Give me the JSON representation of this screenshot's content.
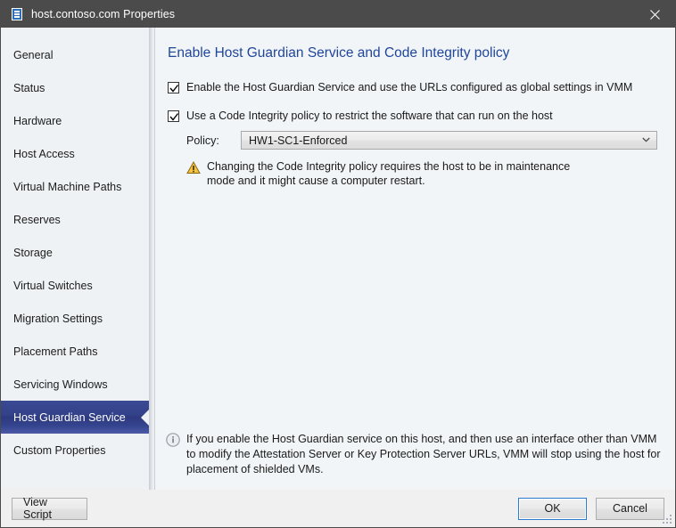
{
  "window": {
    "title": "host.contoso.com Properties",
    "title_icon": "server-icon",
    "close_icon": "close-icon"
  },
  "sidebar": {
    "items": [
      {
        "label": "General",
        "selected": false
      },
      {
        "label": "Status",
        "selected": false
      },
      {
        "label": "Hardware",
        "selected": false
      },
      {
        "label": "Host Access",
        "selected": false
      },
      {
        "label": "Virtual Machine Paths",
        "selected": false
      },
      {
        "label": "Reserves",
        "selected": false
      },
      {
        "label": "Storage",
        "selected": false
      },
      {
        "label": "Virtual Switches",
        "selected": false
      },
      {
        "label": "Migration Settings",
        "selected": false
      },
      {
        "label": "Placement Paths",
        "selected": false
      },
      {
        "label": "Servicing Windows",
        "selected": false
      },
      {
        "label": "Host Guardian Service",
        "selected": true
      },
      {
        "label": "Custom Properties",
        "selected": false
      }
    ]
  },
  "main": {
    "page_title": "Enable Host Guardian Service and Code Integrity policy",
    "checkbox_hgs": {
      "label": "Enable the Host Guardian Service and use the URLs configured as global settings in VMM",
      "checked": true
    },
    "checkbox_ci": {
      "label": "Use a Code Integrity policy to restrict the software that can run on the host",
      "checked": true
    },
    "policy": {
      "label": "Policy:",
      "value": "HW1-SC1-Enforced",
      "chevron": "chevron-down-icon"
    },
    "warning": {
      "icon": "warning-triangle-icon",
      "text": "Changing the Code Integrity policy requires the host to be in maintenance mode and it might cause a computer restart."
    },
    "info": {
      "icon": "info-circle-icon",
      "text": "If you enable the Host Guardian service on this host, and then use an interface other than VMM to modify the Attestation Server or Key Protection Server URLs, VMM will stop using the host for placement of shielded VMs."
    }
  },
  "footer": {
    "view_script_label": "View Script",
    "ok_label": "OK",
    "cancel_label": "Cancel",
    "resize_grip": "resize-grip-icon"
  },
  "colors": {
    "titlebar_bg": "#4b4b4b",
    "selection_blue": "#33418a",
    "heading_blue": "#20469b",
    "default_button_border": "#2a7ad1",
    "warning_amber": "#f5c242",
    "info_gray": "#9aa0a8",
    "sidebar_bg": "#eff2f5",
    "content_bg": "#f2f5f8"
  }
}
